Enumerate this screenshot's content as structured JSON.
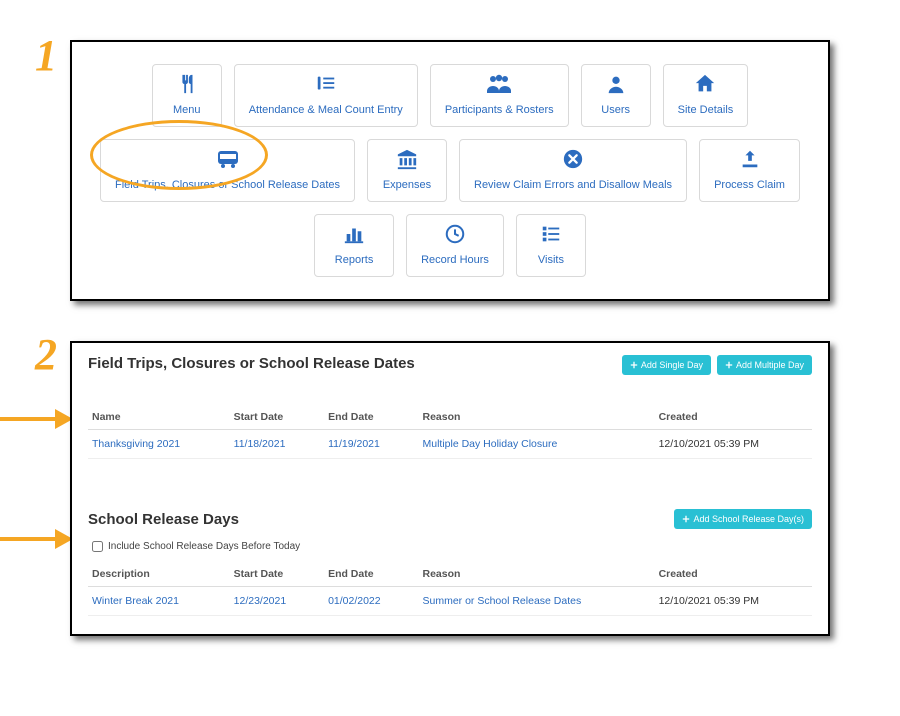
{
  "step1_number": "1",
  "step2_number": "2",
  "tiles": {
    "menu": "Menu",
    "attendance": "Attendance & Meal Count Entry",
    "participants": "Participants & Rosters",
    "users": "Users",
    "site_details": "Site Details",
    "field_trips": "Field Trips, Closures or School Release Dates",
    "expenses": "Expenses",
    "review_errors": "Review Claim Errors and Disallow Meals",
    "process_claim": "Process Claim",
    "reports": "Reports",
    "record_hours": "Record Hours",
    "visits": "Visits"
  },
  "panel2": {
    "title": "Field Trips, Closures or School Release Dates",
    "btn_add_single": "Add Single Day",
    "btn_add_multiple": "Add Multiple Day",
    "table1": {
      "headers": {
        "name": "Name",
        "start": "Start Date",
        "end": "End Date",
        "reason": "Reason",
        "created": "Created"
      },
      "row": {
        "name": "Thanksgiving 2021",
        "start": "11/18/2021",
        "end": "11/19/2021",
        "reason": "Multiple Day Holiday Closure",
        "created": "12/10/2021 05:39 PM"
      }
    },
    "section2_title": "School Release Days",
    "btn_add_school": "Add School Release Day(s)",
    "checkbox_label": "Include School Release Days Before Today",
    "table2": {
      "headers": {
        "desc": "Description",
        "start": "Start Date",
        "end": "End Date",
        "reason": "Reason",
        "created": "Created"
      },
      "row": {
        "desc": "Winter Break 2021",
        "start": "12/23/2021",
        "end": "01/02/2022",
        "reason": "Summer or School Release Dates",
        "created": "12/10/2021 05:39 PM"
      }
    }
  }
}
